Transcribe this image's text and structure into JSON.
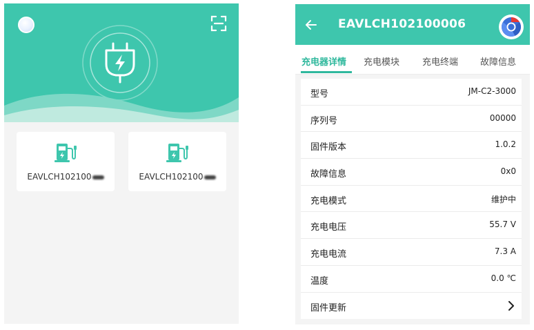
{
  "left_screen": {
    "devices": [
      {
        "label": "EAVLCH102100"
      },
      {
        "label": "EAVLCH102100"
      }
    ]
  },
  "right_screen": {
    "title": "EAVLCH102100006",
    "tabs": [
      {
        "label": "充电器详情",
        "active": true
      },
      {
        "label": "充电模块",
        "active": false
      },
      {
        "label": "充电终端",
        "active": false
      },
      {
        "label": "故障信息",
        "active": false
      }
    ],
    "rows": [
      {
        "label": "型号",
        "value": "JM-C2-3000"
      },
      {
        "label": "序列号",
        "value": "00000"
      },
      {
        "label": "固件版本",
        "value": "1.0.2"
      },
      {
        "label": "故障信息",
        "value": "0x0"
      },
      {
        "label": "充电模式",
        "value": "维护中"
      },
      {
        "label": "充电电压",
        "value": "55.7 V"
      },
      {
        "label": "充电电流",
        "value": "7.3 A"
      },
      {
        "label": "温度",
        "value": "0.0 ℃"
      },
      {
        "label": "固件更新",
        "value": ""
      }
    ]
  },
  "colors": {
    "brand_teal": "#3ec6ad",
    "accent_green": "#2fb89d",
    "background": "#f4f4f4"
  },
  "icons": [
    "avatar",
    "scan-icon",
    "plug-icon",
    "charging-station-icon",
    "back-arrow-icon",
    "app-logo-icon",
    "chevron-right-icon"
  ]
}
